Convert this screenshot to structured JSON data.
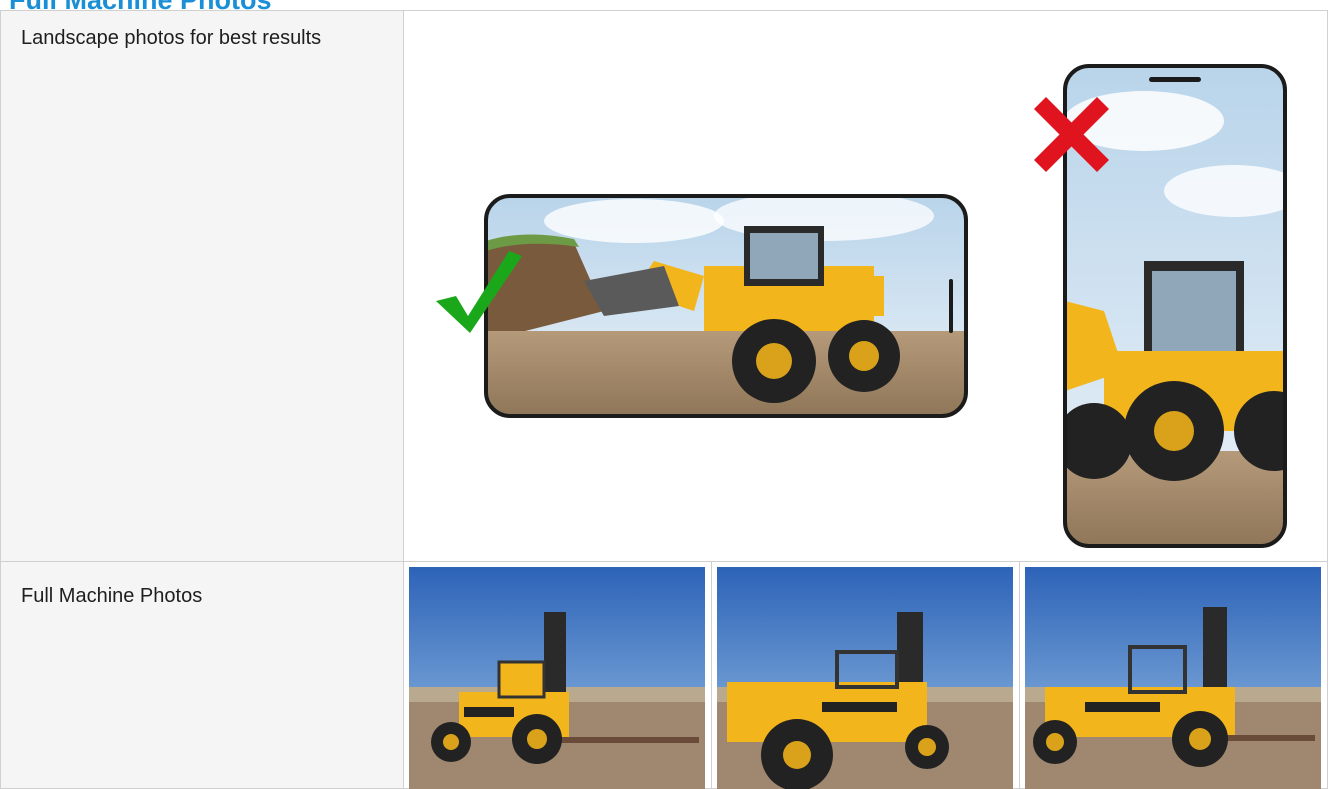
{
  "section": {
    "title": "Full Machine Photos"
  },
  "rows": [
    {
      "label": "Landscape photos for best results"
    },
    {
      "label": "Full Machine Photos"
    }
  ],
  "orientation_guide": {
    "good_example": {
      "orientation": "landscape",
      "mark": "check",
      "mark_color": "#1aa81a"
    },
    "bad_example": {
      "orientation": "portrait",
      "mark": "cross",
      "mark_color": "#e0141e"
    }
  },
  "photos": [
    {
      "subject": "yellow caterpillar forklift, side view"
    },
    {
      "subject": "yellow caterpillar forklift, front three-quarter view"
    },
    {
      "subject": "yellow caterpillar forklift, rear three-quarter view"
    }
  ],
  "colors": {
    "title": "#1a8fd6",
    "label_background": "#f5f5f5",
    "border": "#d0d0d0",
    "machine_yellow": "#f2b51c"
  }
}
